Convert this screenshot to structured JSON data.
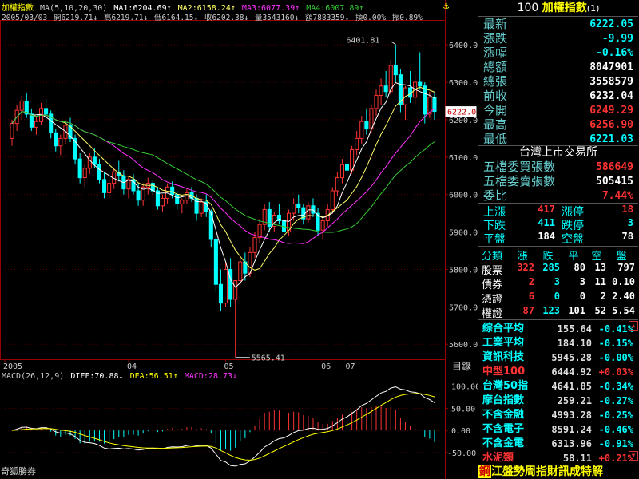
{
  "header": {
    "title": "加權指數",
    "ma_params": "MA(5,10,20,30)",
    "ma1": "MA1:6204.69↑",
    "ma2": "MA2:6158.24↑",
    "ma3": "MA3:6077.39↑",
    "ma4": "MA4:6007.89↑",
    "date": "2005/03/03",
    "open": "開6219.71↓",
    "high": "高6219.71↓",
    "low": "低6164.15↓",
    "close": "收6202.38↓",
    "volume": "量3543160↓",
    "amount": "額7883359↓",
    "turnover": "換0.00%",
    "amplitude": "振0.89%"
  },
  "annotations": {
    "high_label": "6401.81",
    "low_label": "5565.41",
    "current_price": "6222.0"
  },
  "macd_header": {
    "params": "MACD(26,12,9)",
    "diff": "DIFF:70.88↓",
    "dea": "DEA:56.51↑",
    "macd": "MACD:28.73↓"
  },
  "footer": {
    "source": "奇狐勝券",
    "catalog": "目錄"
  },
  "chart_data": [
    {
      "type": "candlestick",
      "title": "加權指數",
      "xlabel": "",
      "ylabel": "",
      "ylim": [
        5560,
        6460
      ],
      "y_ticks": [
        5600,
        5700,
        5800,
        5900,
        6000,
        6100,
        6200,
        6300,
        6400
      ],
      "x_tick_labels": [
        "2005",
        "04",
        "05",
        "06",
        "07"
      ],
      "candles": [
        [
          6150,
          6200,
          6130,
          6190
        ],
        [
          6190,
          6240,
          6170,
          6225
        ],
        [
          6225,
          6265,
          6200,
          6250
        ],
        [
          6250,
          6270,
          6205,
          6215
        ],
        [
          6215,
          6230,
          6170,
          6180
        ],
        [
          6180,
          6210,
          6160,
          6195
        ],
        [
          6195,
          6245,
          6185,
          6230
        ],
        [
          6230,
          6255,
          6205,
          6215
        ],
        [
          6215,
          6225,
          6150,
          6165
        ],
        [
          6165,
          6175,
          6115,
          6130
        ],
        [
          6130,
          6160,
          6105,
          6150
        ],
        [
          6150,
          6195,
          6135,
          6185
        ],
        [
          6185,
          6205,
          6140,
          6150
        ],
        [
          6150,
          6160,
          6080,
          6095
        ],
        [
          6095,
          6110,
          6030,
          6045
        ],
        [
          6045,
          6080,
          6020,
          6070
        ],
        [
          6070,
          6110,
          6055,
          6100
        ],
        [
          6100,
          6125,
          6070,
          6080
        ],
        [
          6080,
          6095,
          6030,
          6040
        ],
        [
          6040,
          6060,
          5990,
          6005
        ],
        [
          6005,
          6045,
          5990,
          6030
        ],
        [
          6030,
          6070,
          6015,
          6060
        ],
        [
          6060,
          6090,
          6035,
          6050
        ],
        [
          6050,
          6065,
          6000,
          6015
        ],
        [
          6015,
          6050,
          5990,
          6040
        ],
        [
          6040,
          6055,
          6000,
          6010
        ],
        [
          6010,
          6030,
          5970,
          5985
        ],
        [
          5985,
          6030,
          5970,
          6020
        ],
        [
          6020,
          6045,
          6000,
          6030
        ],
        [
          6030,
          6040,
          6000,
          6010
        ],
        [
          6010,
          6020,
          5960,
          5970
        ],
        [
          5970,
          6000,
          5955,
          5990
        ],
        [
          5990,
          6030,
          5975,
          6020
        ],
        [
          6020,
          6035,
          5990,
          6000
        ],
        [
          6000,
          6010,
          5960,
          5975
        ],
        [
          5975,
          5990,
          5950,
          5985
        ],
        [
          5985,
          6015,
          5975,
          6005
        ],
        [
          6005,
          6020,
          5980,
          5990
        ],
        [
          5990,
          6000,
          5930,
          5950
        ],
        [
          5950,
          5990,
          5940,
          5980
        ],
        [
          5980,
          6000,
          5940,
          5955
        ],
        [
          5955,
          5960,
          5860,
          5880
        ],
        [
          5880,
          5890,
          5740,
          5760
        ],
        [
          5760,
          5800,
          5690,
          5710
        ],
        [
          5710,
          5820,
          5700,
          5800
        ],
        [
          5800,
          5830,
          5700,
          5720
        ],
        [
          5720,
          5730,
          5565,
          5770
        ],
        [
          5770,
          5830,
          5760,
          5820
        ],
        [
          5820,
          5845,
          5770,
          5790
        ],
        [
          5790,
          5860,
          5780,
          5845
        ],
        [
          5845,
          5900,
          5830,
          5885
        ],
        [
          5885,
          5935,
          5870,
          5920
        ],
        [
          5920,
          5975,
          5905,
          5960
        ],
        [
          5960,
          5980,
          5900,
          5915
        ],
        [
          5915,
          5955,
          5900,
          5945
        ],
        [
          5945,
          5975,
          5920,
          5930
        ],
        [
          5930,
          5950,
          5880,
          5900
        ],
        [
          5900,
          5960,
          5890,
          5950
        ],
        [
          5950,
          5990,
          5930,
          5975
        ],
        [
          5975,
          6000,
          5950,
          5965
        ],
        [
          5965,
          5975,
          5920,
          5935
        ],
        [
          5935,
          5980,
          5925,
          5970
        ],
        [
          5970,
          5990,
          5940,
          5950
        ],
        [
          5950,
          5965,
          5890,
          5905
        ],
        [
          5905,
          5940,
          5880,
          5930
        ],
        [
          5930,
          5975,
          5915,
          5960
        ],
        [
          5960,
          6020,
          5950,
          6010
        ],
        [
          6010,
          6060,
          5995,
          6045
        ],
        [
          6045,
          6095,
          6030,
          6080
        ],
        [
          6080,
          6120,
          6050,
          6065
        ],
        [
          6065,
          6130,
          6055,
          6120
        ],
        [
          6120,
          6170,
          6105,
          6150
        ],
        [
          6150,
          6210,
          6135,
          6195
        ],
        [
          6195,
          6230,
          6160,
          6175
        ],
        [
          6175,
          6240,
          6165,
          6230
        ],
        [
          6230,
          6280,
          6210,
          6265
        ],
        [
          6265,
          6310,
          6240,
          6290
        ],
        [
          6290,
          6330,
          6260,
          6275
        ],
        [
          6275,
          6360,
          6265,
          6345
        ],
        [
          6345,
          6401,
          6300,
          6320
        ],
        [
          6320,
          6335,
          6220,
          6240
        ],
        [
          6240,
          6290,
          6200,
          6285
        ],
        [
          6285,
          6330,
          6245,
          6260
        ],
        [
          6260,
          6320,
          6240,
          6300
        ],
        [
          6300,
          6380,
          6280,
          6290
        ],
        [
          6290,
          6300,
          6190,
          6215
        ],
        [
          6215,
          6275,
          6205,
          6260
        ],
        [
          6260,
          6270,
          6200,
          6222
        ]
      ],
      "series": [
        {
          "name": "MA1",
          "color": "#ffffff"
        },
        {
          "name": "MA2",
          "color": "#ffff66"
        },
        {
          "name": "MA3",
          "color": "#ff33ff"
        },
        {
          "name": "MA4",
          "color": "#33cc33"
        }
      ]
    },
    {
      "type": "macd",
      "title": "MACD(26,12,9)",
      "ylim": [
        -70,
        110
      ],
      "y_ticks": [
        -50.0,
        0.0,
        50.0,
        100.0
      ],
      "series": [
        {
          "name": "DIFF",
          "color": "#ffffff"
        },
        {
          "name": "DEA",
          "color": "#ffff00"
        },
        {
          "name": "MACD",
          "color": "#ff33ff"
        }
      ]
    }
  ],
  "quote_panel": {
    "title_code": "100",
    "title_name": "加權指數",
    "title_suffix": "(1)",
    "rows": [
      {
        "label": "最新",
        "value": "6222.05",
        "color": "#00ffff"
      },
      {
        "label": "漲跌",
        "value": "-9.99",
        "color": "#00ffff"
      },
      {
        "label": "漲幅",
        "value": "-0.16%",
        "color": "#00ffff"
      },
      {
        "label": "總額",
        "value": "8047901",
        "color": "#ffffff"
      },
      {
        "label": "總張",
        "value": "3558579",
        "color": "#ffffff"
      },
      {
        "label": "前收",
        "value": "6232.04",
        "color": "#ffffff"
      },
      {
        "label": "今開",
        "value": "6249.29",
        "color": "#ff3333"
      },
      {
        "label": "最高",
        "value": "6256.90",
        "color": "#ff3333"
      },
      {
        "label": "最低",
        "value": "6221.03",
        "color": "#00ffff"
      }
    ],
    "exchange": "台灣上市交易所",
    "rows2": [
      {
        "label": "五檔委買張數",
        "value": "586649",
        "color": "#ff3333"
      },
      {
        "label": "五檔委賣張數",
        "value": "505415",
        "color": "#ffffff"
      },
      {
        "label": "委比",
        "value": "7.44%",
        "color": "#ff3333"
      }
    ],
    "breadth": [
      {
        "l1": "上漲",
        "v1": "417",
        "c1": "#ff3333",
        "l2": "漲停",
        "v2": "18",
        "c2": "#ff3333"
      },
      {
        "l1": "下跌",
        "v1": "411",
        "c1": "#00ffff",
        "l2": "跌停",
        "v2": "3",
        "c2": "#00ffff"
      },
      {
        "l1": "平盤",
        "v1": "184",
        "c1": "#ffffff",
        "l2": "空盤",
        "v2": "78",
        "c2": "#ffffff"
      }
    ],
    "class_header": [
      "分類",
      "漲",
      "跌",
      "平",
      "空",
      "盤"
    ],
    "class_rows": [
      {
        "name": "股票",
        "up": "322",
        "down": "285",
        "flat": "80",
        "empty": "13",
        "extra": "797"
      },
      {
        "name": "債券",
        "up": "2",
        "down": "3",
        "flat": "3",
        "empty": "11",
        "extra": "0.10"
      },
      {
        "name": "憑證",
        "up": "6",
        "down": "0",
        "flat": "0",
        "empty": "2",
        "extra": "2.40"
      },
      {
        "name": "權證",
        "up": "87",
        "down": "123",
        "flat": "101",
        "empty": "52",
        "extra": "5.54"
      }
    ],
    "indices": [
      {
        "name": "綜合平均",
        "price": "155.64",
        "chg": "-0.41%",
        "name_color": "#00ffff",
        "chg_color": "#00ffff"
      },
      {
        "name": "工業平均",
        "price": "184.10",
        "chg": "-0.15%",
        "name_color": "#00ffff",
        "chg_color": "#00ffff"
      },
      {
        "name": "資訊科技",
        "price": "5945.28",
        "chg": "-0.00%",
        "name_color": "#00ffff",
        "chg_color": "#00ffff"
      },
      {
        "name": "中型100",
        "price": "6444.92",
        "chg": "+0.03%",
        "name_color": "#ff3333",
        "chg_color": "#ff3333"
      },
      {
        "name": "台灣50指",
        "price": "4641.85",
        "chg": "-0.34%",
        "name_color": "#00ffff",
        "chg_color": "#00ffff"
      },
      {
        "name": "摩台指數",
        "price": "259.21",
        "chg": "-0.27%",
        "name_color": "#00ffff",
        "chg_color": "#00ffff"
      },
      {
        "name": "不含金融",
        "price": "4993.28",
        "chg": "-0.25%",
        "name_color": "#00ffff",
        "chg_color": "#00ffff"
      },
      {
        "name": "不含電子",
        "price": "8591.24",
        "chg": "-0.46%",
        "name_color": "#00ffff",
        "chg_color": "#00ffff"
      },
      {
        "name": "不含金電",
        "price": "6313.96",
        "chg": "-0.91%",
        "name_color": "#00ffff",
        "chg_color": "#00ffff"
      },
      {
        "name": "水泥類",
        "price": "58.11",
        "chg": "+0.21%",
        "name_color": "#ff3333",
        "chg_color": "#ff3333"
      }
    ],
    "bottom_label": "鋼",
    "bottom_tabs": "江盤勢周指財訊成特解",
    "colors": {
      "up": "#ff3333",
      "down": "#00ffff",
      "grid": "#660000",
      "axis": "#990000"
    }
  }
}
